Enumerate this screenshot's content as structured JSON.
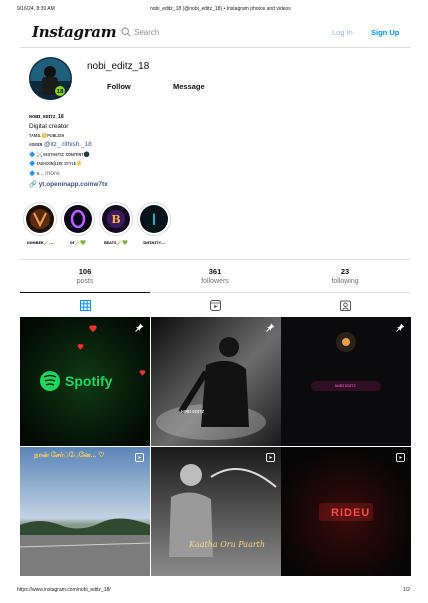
{
  "print_header": {
    "datetime": "9/16/24, 8:39 AM",
    "title": "nobi_editz_18 (@nobi_editz_18) • Instagram photos and videos"
  },
  "nav": {
    "logo": "Instagram",
    "search_placeholder": "Search",
    "login": "Log In",
    "signup": "Sign Up"
  },
  "profile": {
    "username": "nobi_editz_18",
    "follow": "Follow",
    "message": "Message",
    "display_name": "ɴᴏʙɪ_ᴇᴅɪᴛᴢ_18",
    "category": "Digital creator",
    "bio_lines": [
      "ᴛᴀᴍɪʟ💥ᴘᴜʙʟɪsʜ",
      "ᴀᴅᴍɪɴ",
      "🔷 ⚔️ᴀᴇsᴛʜᴇᴛɪᴄ ᴄᴏɴᴛᴇɴᴛ🌑",
      "🔷 ғᴀsʜɪᴏɴ|ʟɪғᴇ sᴛʏʟᴇ☀️",
      "🔷 ᴠ...",
      "more"
    ],
    "admin_handle": "@itz_.rithish._18",
    "link": "yt.openinapp.co/nw7tx"
  },
  "highlights": [
    {
      "label": "ɴᴜᴍʙᴇʀ🪄..."
    },
    {
      "label": "ᴏғ🪄💚"
    },
    {
      "label": "ʙᴇᴀᴛs🪄💚"
    },
    {
      "label": "ɪɴғɪɴɪᴛʏ..."
    }
  ],
  "stats": {
    "posts_value": "106",
    "posts_label": "posts",
    "followers_value": "361",
    "followers_label": "followers",
    "following_value": "23",
    "following_label": "following"
  },
  "tabs": [
    {
      "name": "posts",
      "icon": "grid-icon",
      "active": true
    },
    {
      "name": "reels",
      "icon": "reels-icon",
      "active": false
    },
    {
      "name": "tagged",
      "icon": "tagged-icon",
      "active": false
    }
  ],
  "posts": [
    {
      "type": "pinned",
      "text": "Spotify"
    },
    {
      "type": "pinned",
      "text": "ɴᴏʙɪ ᴇᴅɪᴛᴢ"
    },
    {
      "type": "pinned",
      "text": "ɴᴏʙɪ ᴇᴅɪᴛᴢ"
    },
    {
      "type": "reel",
      "text": "நான் சேர்ப்பேனே... ♡"
    },
    {
      "type": "reel",
      "text": "Kaatha Oru Paarth"
    },
    {
      "type": "reel",
      "text": "RIDEU"
    }
  ],
  "footer": {
    "url": "https://www.instagram.com/nobi_editz_18/",
    "page": "1/2"
  }
}
